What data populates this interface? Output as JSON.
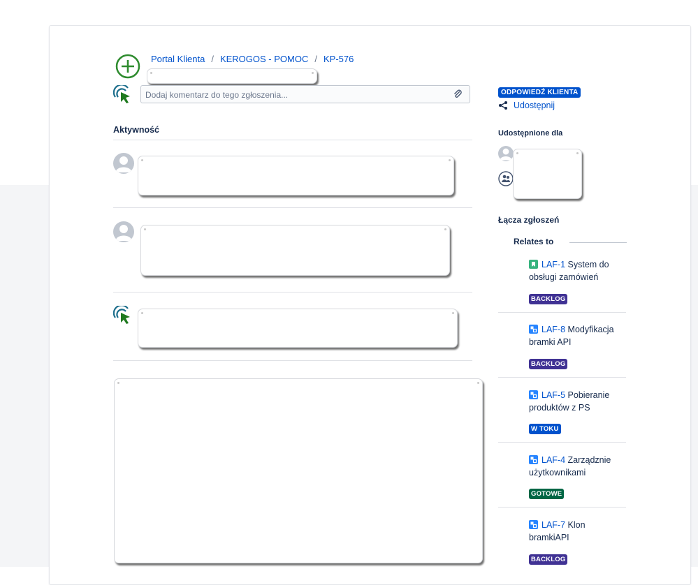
{
  "breadcrumb": {
    "portal": "Portal Klienta",
    "project": "KEROGOS - POMOC",
    "issue": "KP-576"
  },
  "comment": {
    "placeholder": "Dodaj komentarz do tego zgłoszenia..."
  },
  "activity": {
    "title": "Aktywność"
  },
  "sidebar": {
    "status": "ODPOWIEDŹ KLIENTA",
    "share_label": "Udostępnij",
    "shared_with_title": "Udostępnione dla",
    "issue_links_title": "Łącza zgłoszeń",
    "relates_label": "Relates to",
    "links": [
      {
        "key": "LAF-1",
        "title": "System do obsługi zamówień",
        "type": "story",
        "status": "BACKLOG"
      },
      {
        "key": "LAF-8",
        "title": "Modyfikacja bramki API",
        "type": "task",
        "status": "BACKLOG"
      },
      {
        "key": "LAF-5",
        "title": "Pobieranie produktów z PS",
        "type": "task",
        "status": "W TOKU"
      },
      {
        "key": "LAF-4",
        "title": "Zarządznie użytkownikami",
        "type": "task",
        "status": "GOTOWE"
      },
      {
        "key": "LAF-7",
        "title": "Klon bramkiAPI",
        "type": "task",
        "status": "BACKLOG"
      }
    ]
  },
  "colors": {
    "link": "#0052cc",
    "backlog": "#403294",
    "in_progress": "#0052cc",
    "done": "#006644",
    "story": "#36b37e",
    "task": "#2684ff"
  }
}
